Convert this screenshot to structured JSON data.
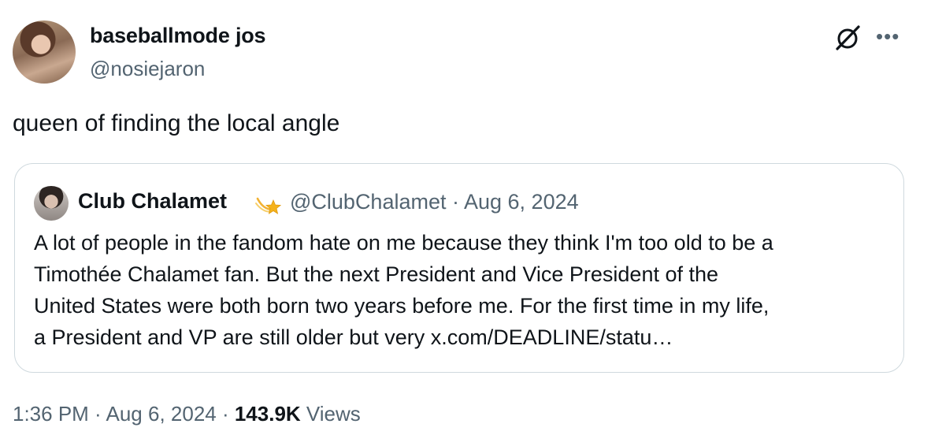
{
  "author": {
    "name": "baseballmode jos",
    "handle": "@nosiejaron"
  },
  "tweet": {
    "text": "queen of finding the local angle"
  },
  "quoted_tweet": {
    "name": "Club Chalamet",
    "badge_icon": "shooting-star-emoji",
    "meta": "@ClubChalamet · Aug 6, 2024",
    "lines": [
      "A lot of people in the fandom hate on me because they think I'm too old to be a",
      "Timothée Chalamet fan. But the next President and Vice President of the",
      "United States were both born two years before me. For the first time in my life,",
      "a President and VP are still older but very x.com/DEADLINE/statu…"
    ]
  },
  "footer": {
    "time": "1:36 PM",
    "sep1": " · ",
    "date": "Aug 6, 2024",
    "sep2": " · ",
    "views_count": "143.9K",
    "views_label": " Views"
  },
  "icons": {
    "grok": "grok-icon",
    "more": "more-icon"
  },
  "colors": {
    "text": "#0f1419",
    "secondary": "#536471",
    "border": "#cfd9de"
  }
}
